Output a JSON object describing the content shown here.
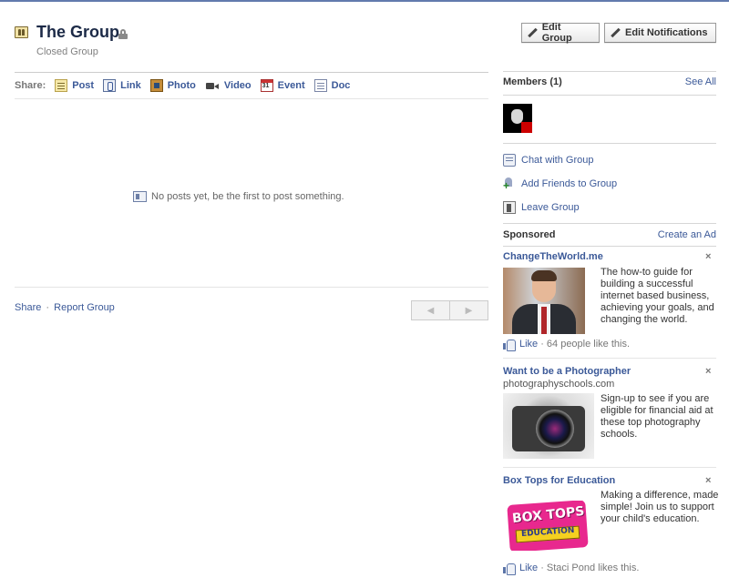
{
  "header": {
    "title": "The Group",
    "subtitle": "Closed Group",
    "icon": "group-icon",
    "privacy_icon": "lock-icon",
    "edit_group_label": "Edit Group",
    "edit_notifications_label": "Edit Notifications"
  },
  "share_bar": {
    "label": "Share:",
    "items": [
      {
        "label": "Post",
        "icon": "post-icon"
      },
      {
        "label": "Link",
        "icon": "link-icon"
      },
      {
        "label": "Photo",
        "icon": "photo-icon"
      },
      {
        "label": "Video",
        "icon": "video-icon"
      },
      {
        "label": "Event",
        "icon": "event-icon"
      },
      {
        "label": "Doc",
        "icon": "doc-icon"
      }
    ]
  },
  "feed": {
    "empty_message": "No posts yet, be the first to post something."
  },
  "footer": {
    "share_link": "Share",
    "separator": "·",
    "report_link": "Report Group"
  },
  "members": {
    "title": "Members (1)",
    "see_all": "See All"
  },
  "actions": [
    {
      "label": "Chat with Group",
      "icon": "chat-icon"
    },
    {
      "label": "Add Friends to Group",
      "icon": "add-friend-icon"
    },
    {
      "label": "Leave Group",
      "icon": "leave-icon"
    }
  ],
  "sponsored": {
    "title": "Sponsored",
    "create_ad": "Create an Ad",
    "ads": [
      {
        "title": "ChangeTheWorld.me",
        "close": "×",
        "body": "The how-to guide for building a successful internet based business, achieving your goals, and changing the world.",
        "like": "Like",
        "like_count": "· 64 people like this."
      },
      {
        "title": "Want to be a Photographer",
        "domain": "photographyschools.com",
        "close": "×",
        "body": "Sign-up to see if you are eligible for financial aid at these top photography schools."
      },
      {
        "title": "Box Tops for Education",
        "close": "×",
        "body": "Making a difference, made simple! Join us to support your child's education.",
        "logo_text_1": "BOX TOPS",
        "logo_text_2": "EDUCATION",
        "like": "Like",
        "like_count": "· Staci Pond likes this."
      }
    ]
  },
  "colors": {
    "link": "#3b5998",
    "title": "#1c2a47",
    "top_border": "#627aad"
  }
}
